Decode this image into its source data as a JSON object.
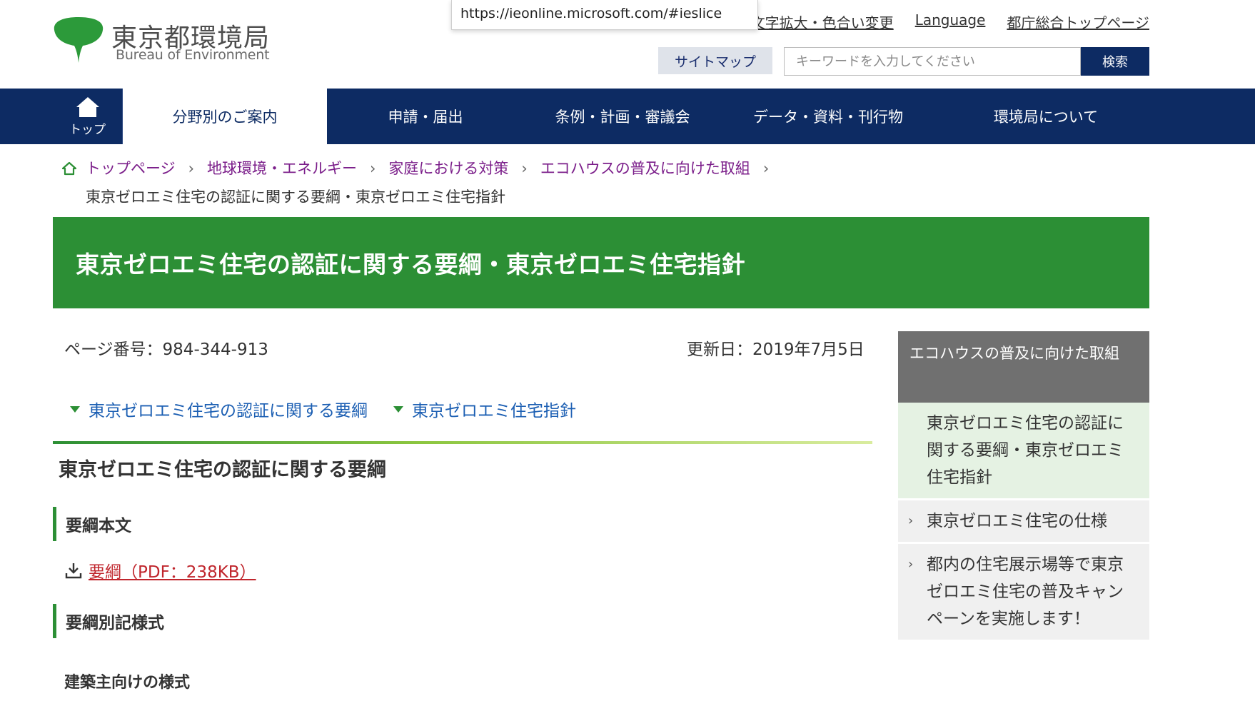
{
  "logo": {
    "name_ja": "東京都環境局",
    "name_en": "Bureau of Environment"
  },
  "tooltip": {
    "url": "https://ieonline.microsoft.com/#ieslice"
  },
  "util_links": [
    "文字拡大・色合い変更",
    "Language",
    "都庁総合トップページ"
  ],
  "sitemap_label": "サイトマップ",
  "search": {
    "placeholder": "キーワードを入力してください",
    "button": "検索"
  },
  "nav": {
    "home_label": "トップ",
    "items": [
      "分野別のご案内",
      "申請・届出",
      "条例・計画・審議会",
      "データ・資料・刊行物",
      "環境局について"
    ]
  },
  "breadcrumb": {
    "links": [
      "トップページ",
      "地球環境・エネルギー",
      "家庭における対策",
      "エコハウスの普及に向けた取組"
    ],
    "current": "東京ゼロエミ住宅の認証に関する要綱・東京ゼロエミ住宅指針"
  },
  "page": {
    "title": "東京ゼロエミ住宅の認証に関する要綱・東京ゼロエミ住宅指針",
    "page_number": "ページ番号：984-344-913",
    "updated": "更新日：2019年7月5日",
    "anchors": [
      "東京ゼロエミ住宅の認証に関する要綱",
      "東京ゼロエミ住宅指針"
    ],
    "section_title": "東京ゼロエミ住宅の認証に関する要綱",
    "sub1": "要綱本文",
    "download_link": "要綱（PDF：238KB）",
    "sub2": "要綱別記様式",
    "sub3": "建築主向けの様式"
  },
  "side": {
    "heading": "エコハウスの普及に向けた取組",
    "items": [
      "東京ゼロエミ住宅の認証に関する要綱・東京ゼロエミ住宅指針",
      "東京ゼロエミ住宅の仕様",
      "都内の住宅展示場等で東京ゼロエミ住宅の普及キャンペーンを実施します！"
    ]
  },
  "colors": {
    "nav_bg": "#0d2b63",
    "title_green": "#2c8f35",
    "link_purple": "#7b1e8a",
    "link_blue": "#1c5fb3",
    "download_red": "#c0262d"
  }
}
